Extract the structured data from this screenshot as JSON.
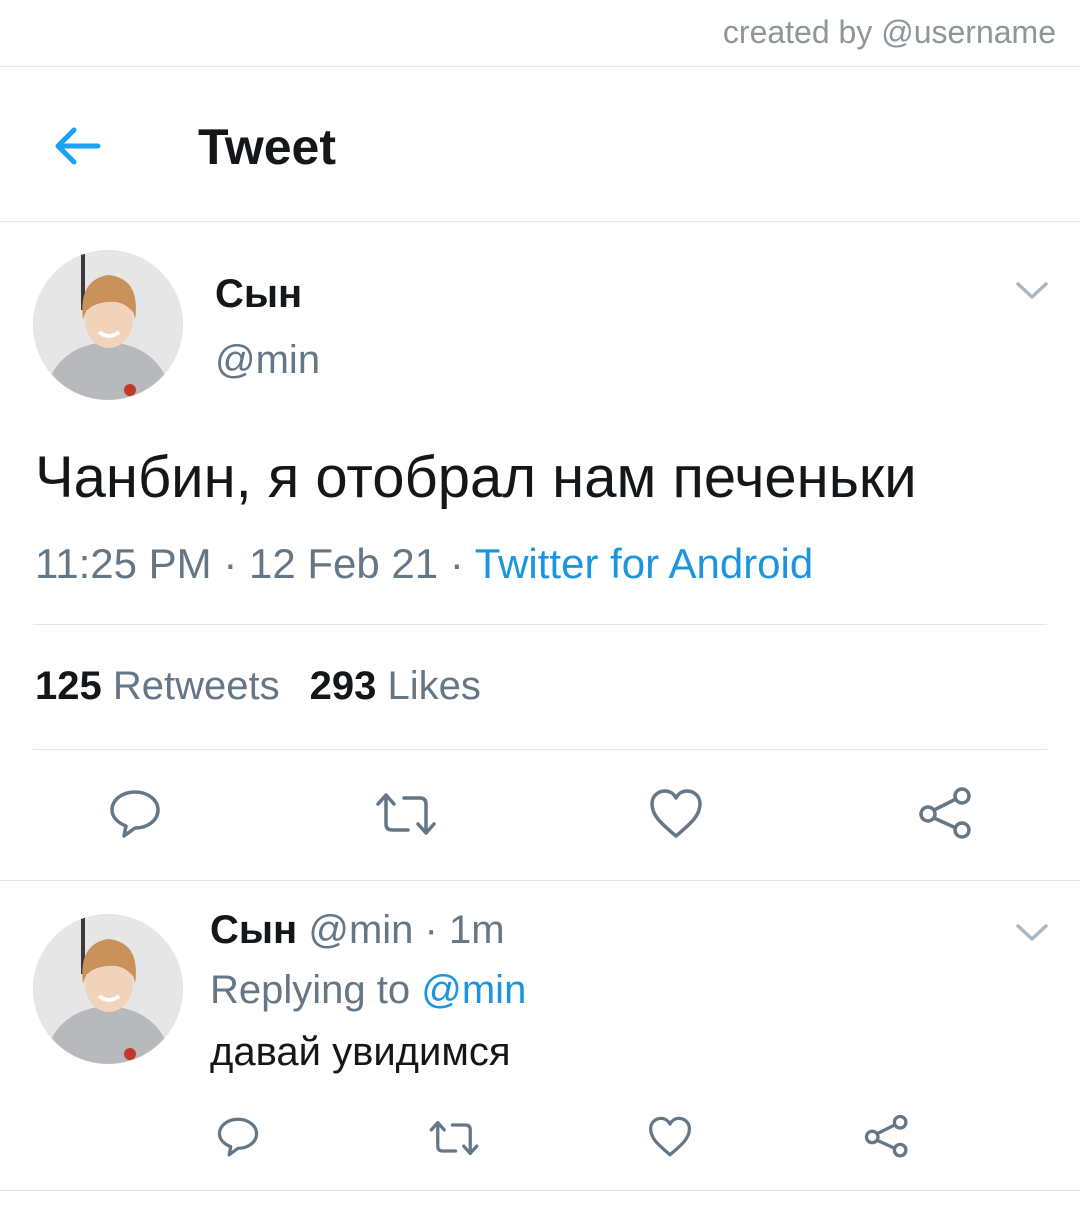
{
  "credit": "created by @username",
  "header": {
    "title": "Tweet",
    "back_icon": "arrow-left-icon",
    "accent": "#1da1f2"
  },
  "tweet": {
    "name": "Сын",
    "handle": "@min",
    "text": "Чанбин, я отобрал нам печеньки",
    "time": "11:25 PM",
    "date": "12 Feb 21",
    "source": "Twitter for Android",
    "separator": "·",
    "retweets_count": "125",
    "retweets_label": "Retweets",
    "likes_count": "293",
    "likes_label": "Likes",
    "actions": [
      "reply-icon",
      "retweet-icon",
      "like-icon",
      "share-icon"
    ]
  },
  "reply": {
    "name": "Сын",
    "handle": "@min",
    "separator": "·",
    "time": "1m",
    "replying_to_label": "Replying to",
    "replying_to_handle": "@min",
    "text": "давай увидимся",
    "actions": [
      "reply-icon",
      "retweet-icon",
      "like-icon",
      "share-icon"
    ]
  },
  "colors": {
    "link": "#1b95e0",
    "secondary": "#657786",
    "divider": "#e1e5e8"
  }
}
